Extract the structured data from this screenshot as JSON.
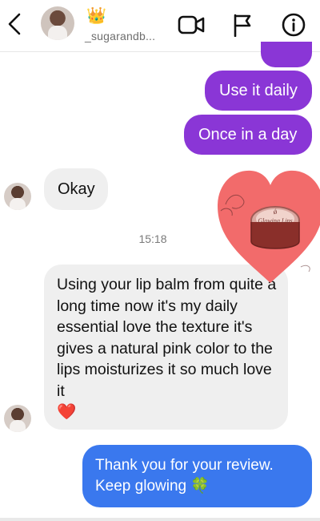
{
  "header": {
    "back_icon": "chevron-left-icon",
    "crown_icon": "👑",
    "username": "_sugarandb...",
    "icons": [
      "video-call-icon",
      "flag-icon",
      "info-icon"
    ]
  },
  "messages": {
    "sent_1": "Use it daily",
    "sent_2": "Once in a day",
    "recv_1": "Okay",
    "timestamp": "15:18",
    "recv_2": "Using your lip balm from quite a long time now it's my daily essential love the texture it's gives a natural pink color to the lips moisturizes it so much love it",
    "recv_2_emoji": "❤️",
    "sent_3_line1": "Thank you for your review.",
    "sent_3_line2": "Keep glowing 🍀"
  },
  "sticker": {
    "type": "heart-sticker",
    "jar_label": "Glowing Lips",
    "jar_mark": "ǿ"
  },
  "colors": {
    "purple_bubble": "#8a36d6",
    "blue_bubble": "#3a78ee",
    "received_bubble": "#efefef",
    "heart": "#f26b6b"
  }
}
